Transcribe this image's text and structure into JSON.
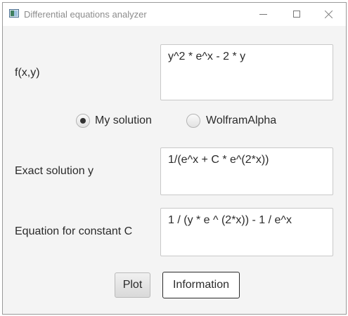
{
  "window": {
    "title": "Differential equations analyzer"
  },
  "fields": {
    "fxy": {
      "label": "f(x,y)",
      "value": "y^2 * e^x - 2 * y"
    },
    "exact": {
      "label": "Exact solution y",
      "value": "1/(e^x + C * e^(2*x))"
    },
    "constant": {
      "label": "Equation for constant C",
      "value": "1 / (y * e ^ (2*x)) - 1 / e^x"
    }
  },
  "radios": {
    "my_solution": {
      "label": "My solution",
      "selected": true
    },
    "wolfram": {
      "label": "WolframAlpha",
      "selected": false
    }
  },
  "buttons": {
    "plot": "Plot",
    "information": "Information"
  }
}
